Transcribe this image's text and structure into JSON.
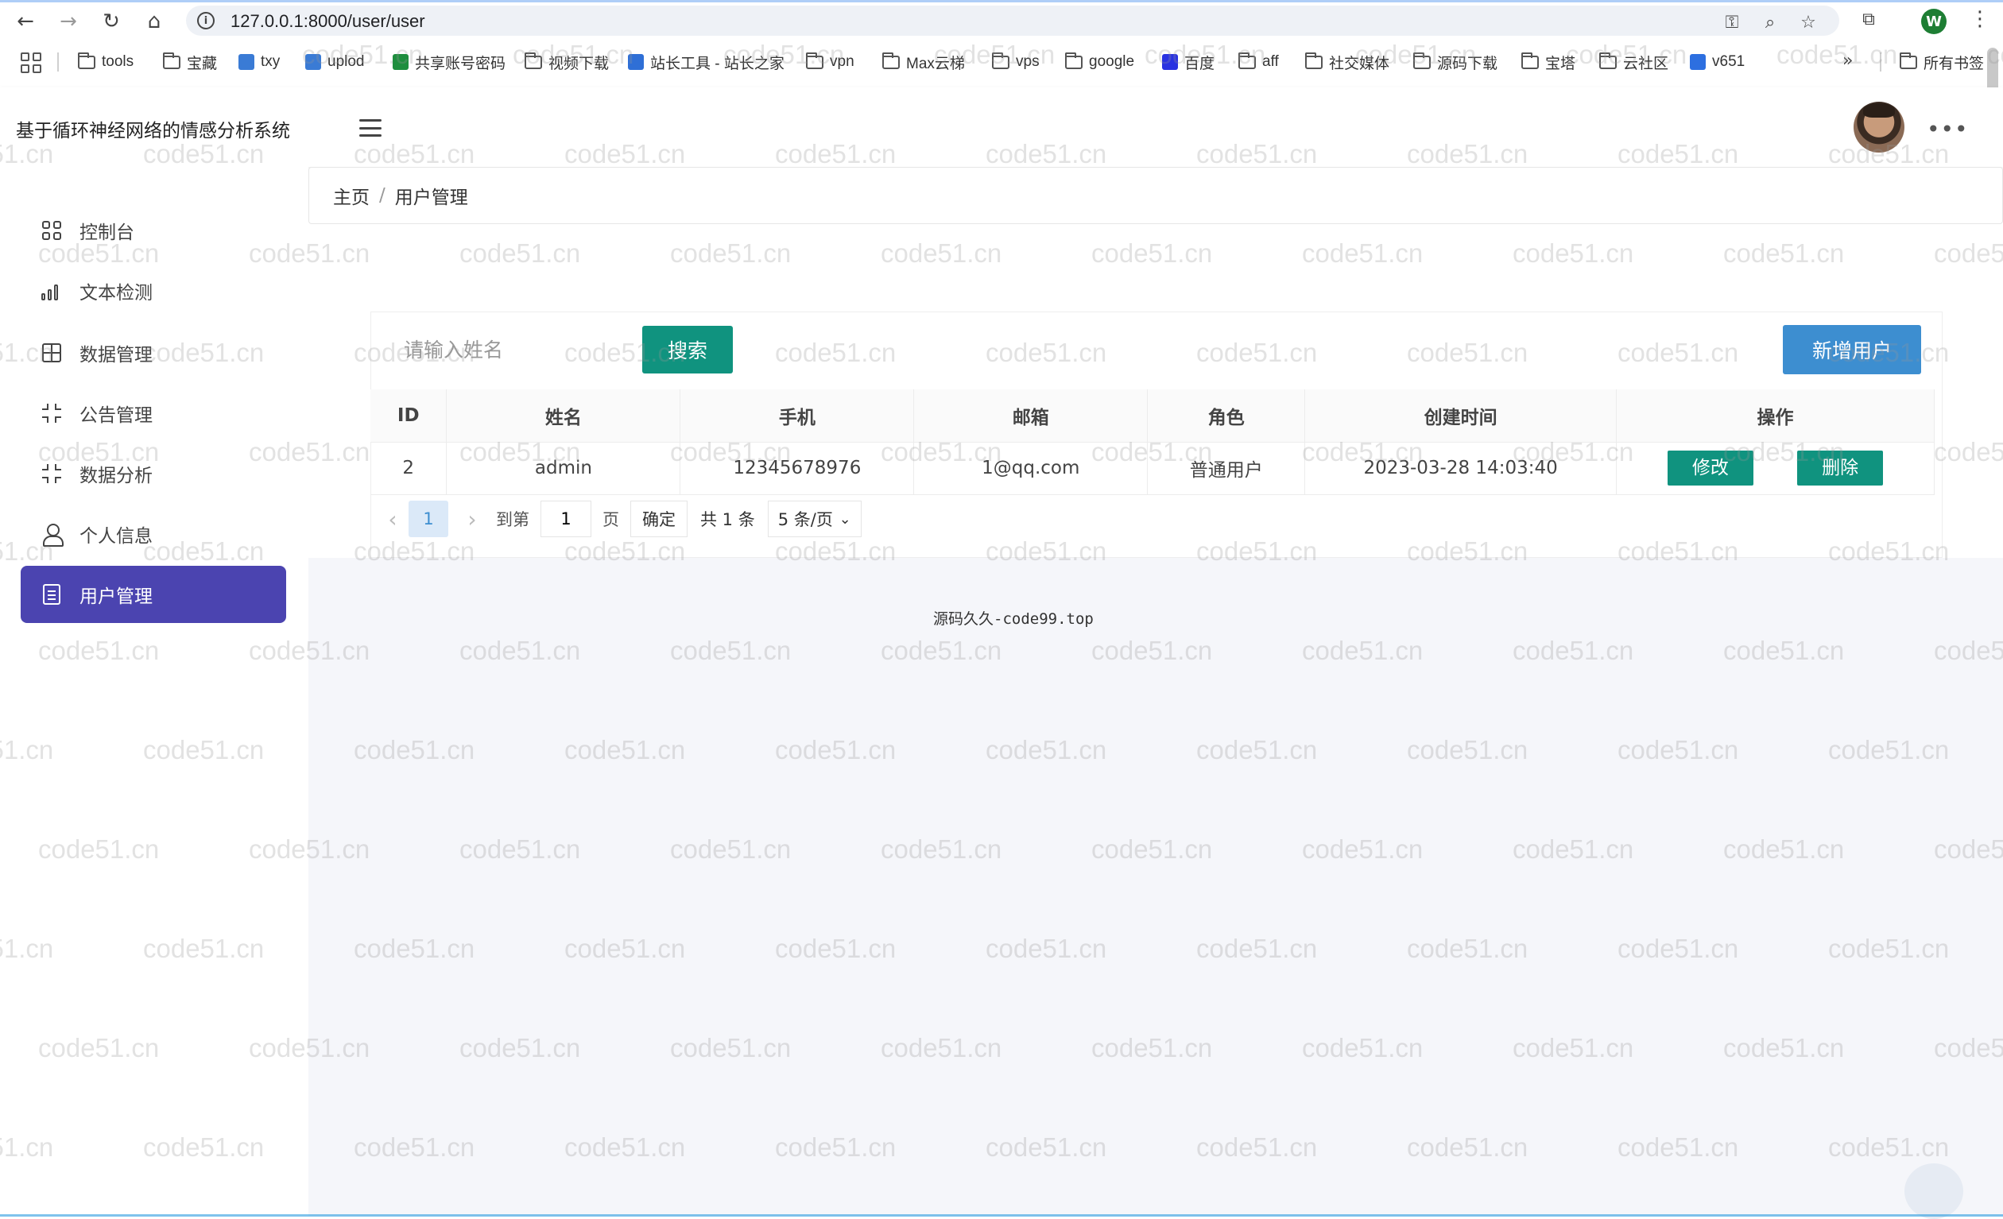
{
  "browser": {
    "url": "127.0.0.1:8000/user/user",
    "bookmarks": [
      {
        "label": "tools",
        "icon": "folder-icon"
      },
      {
        "label": "宝藏",
        "icon": "folder-icon"
      },
      {
        "label": "txy",
        "icon": "cloud-icon"
      },
      {
        "label": "uplod",
        "icon": "cloud-icon"
      },
      {
        "label": "共享账号密码",
        "icon": "sheet-icon"
      },
      {
        "label": "视频下载",
        "icon": "folder-icon"
      },
      {
        "label": "站长工具 - 站长之家",
        "icon": "site-icon"
      },
      {
        "label": "vpn",
        "icon": "folder-icon"
      },
      {
        "label": "Max云梯",
        "icon": "folder-icon"
      },
      {
        "label": "vps",
        "icon": "folder-icon"
      },
      {
        "label": "google",
        "icon": "folder-icon"
      },
      {
        "label": "百度",
        "icon": "baidu-icon"
      },
      {
        "label": "aff",
        "icon": "folder-icon"
      },
      {
        "label": "社交媒体",
        "icon": "folder-icon"
      },
      {
        "label": "源码下载",
        "icon": "folder-icon"
      },
      {
        "label": "宝塔",
        "icon": "folder-icon"
      },
      {
        "label": "云社区",
        "icon": "folder-icon"
      },
      {
        "label": "v651",
        "icon": "v-icon"
      }
    ],
    "all_bookmarks": "所有书签",
    "profile_initial": "W"
  },
  "header": {
    "title": "基于循环神经网络的情感分析系统",
    "more": "•••"
  },
  "sidebar": {
    "items": [
      {
        "label": "控制台",
        "icon": "grid-icon",
        "active": false
      },
      {
        "label": "文本检测",
        "icon": "bar-chart-icon",
        "active": false
      },
      {
        "label": "数据管理",
        "icon": "table-icon",
        "active": false
      },
      {
        "label": "公告管理",
        "icon": "scan-icon",
        "active": false
      },
      {
        "label": "数据分析",
        "icon": "scan-icon",
        "active": false
      },
      {
        "label": "个人信息",
        "icon": "user-icon",
        "active": false
      },
      {
        "label": "用户管理",
        "icon": "document-icon",
        "active": true
      }
    ]
  },
  "breadcrumb": {
    "home": "主页",
    "separator": "/",
    "current": "用户管理"
  },
  "toolbar": {
    "search_placeholder": "请输入姓名",
    "search_label": "搜索",
    "add_label": "新增用户"
  },
  "table": {
    "columns": [
      "ID",
      "姓名",
      "手机",
      "邮箱",
      "角色",
      "创建时间",
      "操作"
    ],
    "rows": [
      {
        "id": "2",
        "name": "admin",
        "phone": "12345678976",
        "email": "1@qq.com",
        "role": "普通用户",
        "created": "2023-03-28 14:03:40",
        "edit": "修改",
        "delete": "删除"
      }
    ]
  },
  "pagination": {
    "prev": "‹",
    "current_page": "1",
    "next": "›",
    "goto_label": "到第",
    "goto_value": "1",
    "page_unit": "页",
    "confirm": "确定",
    "total": "共 1 条",
    "page_size": "5 条/页"
  },
  "footer": {
    "text": "源码久久-code99.top"
  },
  "watermark": "code51.cn",
  "colors": {
    "primary": "#10937f",
    "accent": "#3d8ed0",
    "sidebar_active": "#4b44b0"
  }
}
